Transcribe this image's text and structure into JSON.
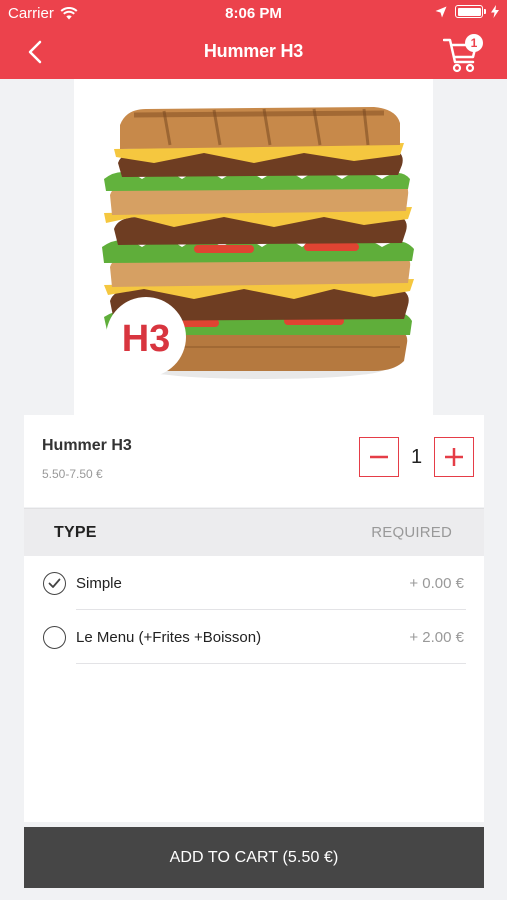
{
  "status_bar": {
    "carrier": "Carrier",
    "time": "8:06 PM"
  },
  "nav": {
    "title": "Hummer H3",
    "cart_count": "1"
  },
  "product": {
    "name": "Hummer H3",
    "price_range": "5.50-7.50 €",
    "image_badge": "H3",
    "quantity": "1"
  },
  "type_section": {
    "title": "TYPE",
    "required_label": "REQUIRED",
    "options": [
      {
        "label": "Simple",
        "price": "+ 0.00 €",
        "selected": true
      },
      {
        "label": "Le Menu (+Frites +Boisson)",
        "price": "+ 2.00 €",
        "selected": false
      }
    ]
  },
  "add_to_cart_label": "ADD TO CART (5.50 €)",
  "colors": {
    "brand_red": "#ec424c",
    "button_dark": "#464646",
    "muted_text": "#999999"
  },
  "icons": [
    "wifi-icon",
    "location-arrow-icon",
    "battery-icon",
    "charging-bolt-icon",
    "back-chevron-icon",
    "cart-icon",
    "minus-icon",
    "plus-icon",
    "checkmark-icon"
  ]
}
